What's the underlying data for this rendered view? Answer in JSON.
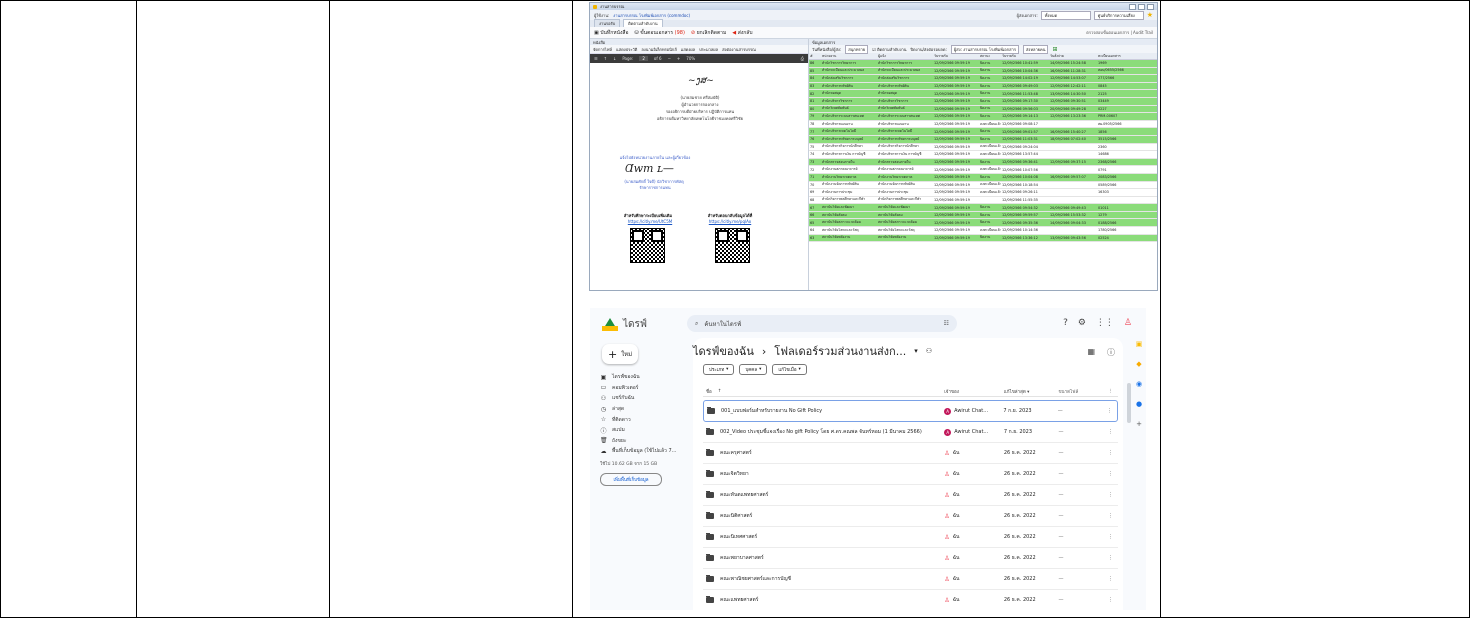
{
  "desktop": {
    "window_title": "งานสารบรรณ",
    "user_label": "ผู้ใช้งาน:",
    "user_value": "งานสารบรรณ โรงพิมพ์เอกสาร (commdoc)",
    "doc_type_label": "ผู้ส่งเอกสาร:",
    "doc_type_value": "ทั้งหมด",
    "unit_value": "ศูนย์บริการความเสี่ยง",
    "tabs": [
      "งานรอรับ",
      "ติดตามลำดับงาน"
    ],
    "toolbar": {
      "save": "บันทึกหนังสือ",
      "steps": "ขั้นตอนเอกสาร",
      "steps_count": "(98)",
      "cancel": "ยกเลิกติดตาม",
      "forward": "ส่งกลับ",
      "right_text": "ตรวจสอบขั้นตอนเอกสาร | Audit Trail"
    },
    "left_panel_title": "หนังสือ",
    "left_tools": [
      "จัดการไฟล์",
      "แสดงประวัติ",
      "ลงนามอิเล็กทรอนิกส์",
      "แสดงผล",
      "ประมวลผล",
      "ส่งต่องานสารบรรณ"
    ],
    "pdf": {
      "page_label": "Page:",
      "page_value": "2",
      "page_total": "of 6",
      "zoom": "70%",
      "signer_name": "(นายสมชาย  ศรีสมบัติ)",
      "signer_title": "ผู้อำนวยการกองกลาง",
      "signer_line2": "รองอธิการบดีฝ่ายบริหาร ปฏิบัติการแทน",
      "signer_line3": "อธิการบดีมหาวิทยาลัยเทคโนโลยีราชมงคลศรีวิชัย",
      "note_line1": "แจ้งไปยังหน่วยงานภายใน และผู้เกี่ยวข้อง",
      "note_line2": "(นายสมศักดิ์ ใจดี) นักวิชาการพัสดุ",
      "note_line3": "รักษาราชการแทน",
      "qr1_title": "สำหรับศึกษาระเบียบเพิ่มเติม",
      "qr1_link": "https://citly.me/UtC5M",
      "qr2_title": "สำหรับตอบกลับข้อมูลได้ที่",
      "qr2_link": "https://citly.me/pqlAo"
    },
    "right_panel_title": "ข้อมูลเอกสาร",
    "filter": {
      "label": "วันที่หนังสือ/ผู้ส่ง:",
      "value": "สนุกทราย",
      "checkbox": "ติดตามลำดับงาน",
      "status_label": "ปิดงาน/ส่งต่อรอบลด:",
      "status_value": "ผู้ส่ง: งานสารบรรณ โรงพิมพ์เอกสาร",
      "final": "ส่งหลายคน"
    },
    "grid_headers": [
      "#",
      "หน่วยงาน",
      "ผู้แจ้ง",
      "วันรายรับ",
      "สถานะ",
      "วันรายรับ",
      "วันสั่งจ่าย",
      "ทะเบียนเอกสาร"
    ],
    "grid_rows": [
      {
        "n": "86",
        "a": "สำนักวิชาการวิทยาการ",
        "b": "สำนักวิชาการวิทยาการ",
        "c": "12/09/2566 09:59:19",
        "d": "ปิดงาน",
        "e": "12/09/2566 10:41:59",
        "f": "14/09/2566 15:24:58",
        "g": "1969",
        "hl": true
      },
      {
        "n": "85",
        "a": "สำนักทะเบียนและประมวลผล",
        "b": "สำนักทะเบียนและประมวลผล",
        "c": "12/09/2566 09:59:19",
        "d": "ปิดงาน",
        "e": "12/09/2566 10:04:36",
        "f": "16/09/2566 11:28:31",
        "g": "สอบ/0655/2566",
        "hl": true
      },
      {
        "n": "84",
        "a": "สำนักส่งเสริมวิชาการ",
        "b": "สำนักส่งเสริมวิชาการ",
        "c": "12/09/2566 09:59:19",
        "d": "ปิดงาน",
        "e": "12/09/2566 14:02:19",
        "f": "12/09/2566 14:53:07",
        "g": "277/2566",
        "hl": true
      },
      {
        "n": "83",
        "a": "สำนักบริหารทรัพย์สิน",
        "b": "สำนักบริหารทรัพย์สิน",
        "c": "12/09/2566 09:59:19",
        "d": "ปิดงาน",
        "e": "12/09/2566 09:49:03",
        "f": "12/09/2566 12:42:11",
        "g": "0845",
        "hl": true
      },
      {
        "n": "82",
        "a": "สำนักหอสมุด",
        "b": "สำนักหอสมุด",
        "c": "12/09/2566 09:59:19",
        "d": "ปิดงาน",
        "e": "12/09/2566 11:53:48",
        "f": "13/09/2566 14:30:50",
        "g": "2125",
        "hl": true
      },
      {
        "n": "81",
        "a": "สำนักบริหารวิชาการ",
        "b": "สำนักบริหารวิชาการ",
        "c": "12/09/2566 09:59:19",
        "d": "ปิดงาน",
        "e": "12/09/2566 09:17:30",
        "f": "12/09/2566 09:30:51",
        "g": "03449",
        "hl": true
      },
      {
        "n": "80",
        "a": "สำนักวิเทศสัมพันธ์",
        "b": "สำนักวิเทศสัมพันธ์",
        "c": "12/09/2566 09:59:19",
        "d": "ปิดงาน",
        "e": "12/09/2566 09:56:03",
        "f": "20/09/2566 09:49:28",
        "g": "0227",
        "hl": true
      },
      {
        "n": "79",
        "a": "สำนักบริหารระบบสารสนเทศ",
        "b": "สำนักบริหารระบบสารสนเทศ",
        "c": "12/09/2566 09:59:19",
        "d": "ปิดงาน",
        "e": "12/09/2566 09:14:13",
        "f": "12/09/2566 13:23:36",
        "g": "PRM-00607",
        "hl": true
      },
      {
        "n": "78",
        "a": "สำนักบริหารแผนงาน",
        "b": "สำนักบริหารแผนงาน",
        "c": "12/09/2566 09:59:19",
        "d": "ลงทะเบียนแล้ว",
        "e": "12/09/2566 09:08:17",
        "f": "",
        "g": "สผ.0905/2566",
        "hl": false
      },
      {
        "n": "77",
        "a": "สำนักบริหารเทคโนโลยี",
        "b": "สำนักบริหารเทคโนโลยี",
        "c": "12/09/2566 09:59:19",
        "d": "ปิดงาน",
        "e": "12/09/2566 09:01:57",
        "f": "16/09/2566 15:40:27",
        "g": "1856",
        "hl": true
      },
      {
        "n": "76",
        "a": "สำนักบริหารทรัพยากรมนุษย์",
        "b": "สำนักบริหารทรัพยากรมนุษย์",
        "c": "12/09/2566 09:59:19",
        "d": "ปิดงาน",
        "e": "12/09/2566 11:03:31",
        "f": "18/09/2566 07:02:40",
        "g": "3515/2566",
        "hl": true
      },
      {
        "n": "75",
        "a": "สำนักบริหารกิจการนักศึกษา",
        "b": "สำนักบริหารกิจการนักศึกษา",
        "c": "12/09/2566 09:59:19",
        "d": "ลงทะเบียนแล้ว",
        "e": "12/09/2566 09:24:04",
        "f": "",
        "g": "2360",
        "hl": false
      },
      {
        "n": "74",
        "a": "สำนักบริหารการเงิน การบัญชี",
        "b": "สำนักบริหารการเงิน การบัญชี",
        "c": "12/09/2566 09:59:19",
        "d": "ลงทะเบียนแล้ว",
        "e": "12/09/2566 13:57:44",
        "f": "",
        "g": "14686",
        "hl": false
      },
      {
        "n": "73",
        "a": "สำนักตรวจสอบภายใน",
        "b": "สำนักตรวจสอบภายใน",
        "c": "12/09/2566 09:59:19",
        "d": "ปิดงาน",
        "e": "12/09/2566 09:36:41",
        "f": "12/09/2566 09:37:15",
        "g": "2368/2566",
        "hl": true
      },
      {
        "n": "72",
        "a": "สำนักงานสภาคณาจารย์",
        "b": "สำนักงานสภาคณาจารย์",
        "c": "12/09/2566 09:59:19",
        "d": "ลงทะเบียนแล้ว",
        "e": "12/09/2566 10:07:56",
        "f": "",
        "g": "0791",
        "hl": false
      },
      {
        "n": "71",
        "a": "สำนักงานวิทยาเขตภาค",
        "b": "สำนักงานวิทยาเขตภาค",
        "c": "12/09/2566 09:59:19",
        "d": "ปิดงาน",
        "e": "12/09/2566 10:04:08",
        "f": "16/09/2566 09:57:07",
        "g": "2083/2566",
        "hl": true
      },
      {
        "n": "70",
        "a": "สำนักงานจัดการทรัพย์สิน",
        "b": "สำนักงานจัดการทรัพย์สิน",
        "c": "12/09/2566 09:59:19",
        "d": "ลงทะเบียนแล้ว",
        "e": "12/09/2566 10:18:54",
        "f": "",
        "g": "0589/2566",
        "hl": false
      },
      {
        "n": "69",
        "a": "สำนักงานการประชุม",
        "b": "สำนักงานการประชุม",
        "c": "12/09/2566 09:59:19",
        "d": "ลงทะเบียนแล้ว",
        "e": "12/09/2566 09:26:11",
        "f": "",
        "g": "16303",
        "hl": false
      },
      {
        "n": "68",
        "a": "สำนักกิจการพลศึกษาและกีฬา",
        "b": "สำนักกิจการพลศึกษาและกีฬา",
        "c": "12/09/2566 09:59:19",
        "d": "",
        "e": "12/09/2566 11:55:35",
        "f": "",
        "g": "",
        "hl": false
      },
      {
        "n": "67",
        "a": "สถาบันวิจัยและพัฒนา",
        "b": "สถาบันวิจัยและพัฒนา",
        "c": "12/09/2566 09:59:19",
        "d": "ปิดงาน",
        "e": "12/09/2566 09:54:32",
        "f": "20/09/2566 09:49:43",
        "g": "01011",
        "hl": true
      },
      {
        "n": "66",
        "a": "สถาบันวิจัยสังคม",
        "b": "สถาบันวิจัยสังคม",
        "c": "12/09/2566 09:59:19",
        "d": "ปิดงาน",
        "e": "12/09/2566 09:59:57",
        "f": "12/09/2566 15:53:32",
        "g": "1279",
        "hl": true
      },
      {
        "n": "65",
        "a": "สถาบันวิจัยสภาวะแวดล้อม",
        "b": "สถาบันวิจัยสภาวะแวดล้อม",
        "c": "12/09/2566 09:59:19",
        "d": "ปิดงาน",
        "e": "12/09/2566 09:35:36",
        "f": "14/09/2566 09:04:33",
        "g": "0188/2566",
        "hl": true
      },
      {
        "n": "64",
        "a": "สถาบันวิจัยโลหะและวัสดุ",
        "b": "สถาบันวิจัยโลหะและวัสดุ",
        "c": "12/09/2566 09:59:19",
        "d": "ลงทะเบียนแล้ว",
        "e": "12/09/2566 10:14:36",
        "f": "",
        "g": "1780/2566",
        "hl": false
      },
      {
        "n": "63",
        "a": "สถาบันวิจัยพลังงาน",
        "b": "สถาบันวิจัยพลังงาน",
        "c": "12/09/2566 09:59:19",
        "d": "ปิดงาน",
        "e": "12/09/2566 13:36:12",
        "f": "13/09/2566 09:43:56",
        "g": "02524",
        "hl": true
      }
    ]
  },
  "drive": {
    "app_name": "ไดรฟ์",
    "search_placeholder": "ค้นหาในไดรฟ์",
    "new_label": "ใหม่",
    "nav": [
      {
        "label": "ไดรฟ์ของฉัน",
        "icon": "drive-icon"
      },
      {
        "label": "คอมพิวเตอร์",
        "icon": "computer-icon"
      },
      {
        "label": "แชร์กับฉัน",
        "icon": "shared-icon"
      },
      {
        "label": "ล่าสุด",
        "icon": "clock-icon"
      },
      {
        "label": "ที่ติดดาว",
        "icon": "star-icon"
      },
      {
        "label": "สแปม",
        "icon": "spam-icon"
      },
      {
        "label": "ถังขยะ",
        "icon": "trash-icon"
      },
      {
        "label": "พื้นที่เก็บข้อมูล (ใช้ไปแล้ว 7...",
        "icon": "cloud-icon"
      }
    ],
    "storage_text": "ใช้ไป 10.62 GB จาก 15 GB",
    "get_more": "เพิ่มพื้นที่เก็บข้อมูล",
    "breadcrumb_root": "ไดรฟ์ของฉัน",
    "breadcrumb_sep": "›",
    "breadcrumb_current": "โฟลเดอร์รวมส่วนงานส่งก...",
    "chips": [
      "ประเภท",
      "บุคคล",
      "แก้ไขเมื่อ"
    ],
    "headers": {
      "name": "ชื่อ",
      "owner": "เจ้าของ",
      "modified": "แก้ไขล่าสุด",
      "size": "ขนาดไฟล์"
    },
    "rows": [
      {
        "name": "001_แบบฟอร์มสำหรับรายงาน No Gift Policy",
        "owner": "Awirut Chat...",
        "owner_type": "avatar",
        "avatar_letter": "A",
        "modified": "7 ก.ย. 2023",
        "size": "—",
        "selected": true
      },
      {
        "name": "002_Video ประชุมชี้แจงเรื่อง No gift Policy โดย ศ.ดร.คณพล จันทร์หอม (1 มีนาคม 2566)",
        "owner": "Awirut Chat...",
        "owner_type": "avatar",
        "avatar_letter": "A",
        "modified": "7 ก.ย. 2023",
        "size": "—",
        "selected": false
      },
      {
        "name": "คณะครุศาสตร์",
        "owner": "ฉัน",
        "owner_type": "me",
        "modified": "26 ธ.ค. 2022",
        "size": "—",
        "selected": false
      },
      {
        "name": "คณะจิตวิทยา",
        "owner": "ฉัน",
        "owner_type": "me",
        "modified": "26 ธ.ค. 2022",
        "size": "—",
        "selected": false
      },
      {
        "name": "คณะทันตแพทยศาสตร์",
        "owner": "ฉัน",
        "owner_type": "me",
        "modified": "26 ธ.ค. 2022",
        "size": "—",
        "selected": false
      },
      {
        "name": "คณะนิติศาสตร์",
        "owner": "ฉัน",
        "owner_type": "me",
        "modified": "26 ธ.ค. 2022",
        "size": "—",
        "selected": false
      },
      {
        "name": "คณะนิเทศศาสตร์",
        "owner": "ฉัน",
        "owner_type": "me",
        "modified": "26 ธ.ค. 2022",
        "size": "—",
        "selected": false
      },
      {
        "name": "คณะพยาบาลศาสตร์",
        "owner": "ฉัน",
        "owner_type": "me",
        "modified": "26 ธ.ค. 2022",
        "size": "—",
        "selected": false
      },
      {
        "name": "คณะพาณิชยศาสตร์และการบัญชี",
        "owner": "ฉัน",
        "owner_type": "me",
        "modified": "26 ธ.ค. 2022",
        "size": "—",
        "selected": false
      },
      {
        "name": "คณะแพทยศาสตร์",
        "owner": "ฉัน",
        "owner_type": "me",
        "modified": "26 ธ.ค. 2022",
        "size": "—",
        "selected": false
      }
    ]
  }
}
